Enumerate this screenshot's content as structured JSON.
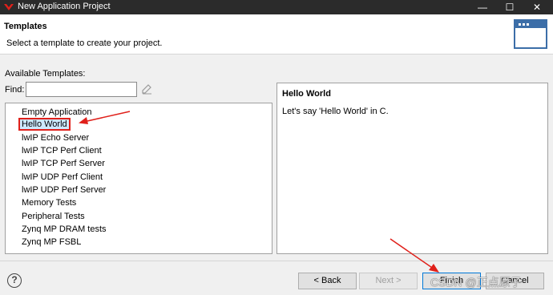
{
  "window": {
    "title": "New Application Project",
    "minimize_glyph": "—",
    "maximize_glyph": "☐",
    "close_glyph": "✕"
  },
  "banner": {
    "heading": "Templates",
    "description": "Select a template to create your project."
  },
  "templates": {
    "available_label": "Available Templates:",
    "find_label": "Find:",
    "find_value": "",
    "items": [
      "Empty Application",
      "Hello World",
      "lwIP Echo Server",
      "lwIP TCP Perf Client",
      "lwIP TCP Perf Server",
      "lwIP UDP Perf Client",
      "lwIP UDP Perf Server",
      "Memory Tests",
      "Peripheral Tests",
      "Zynq MP DRAM tests",
      "Zynq MP FSBL"
    ],
    "selected": "Hello World"
  },
  "description": {
    "title": "Hello World",
    "text": "Let's say 'Hello World' in C."
  },
  "buttons": {
    "help": "?",
    "back": "< Back",
    "next": "Next >",
    "finish": "Finish",
    "cancel": "Cancel"
  },
  "watermark": "CSDN @正点原子",
  "colors": {
    "titlebar": "#2b2b2b",
    "selection": "#cce8ff",
    "annotation_red": "#e0201a",
    "accent_blue": "#3c6ea8"
  }
}
